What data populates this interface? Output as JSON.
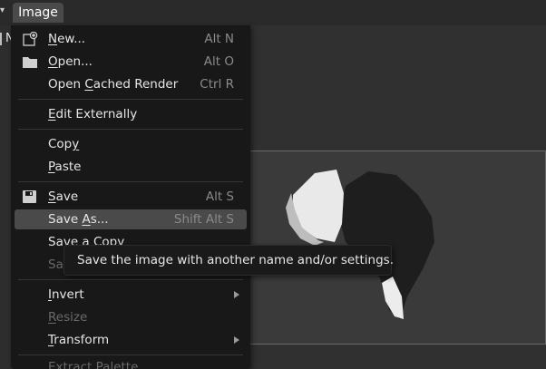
{
  "header": {
    "menu_label": "Image",
    "left_arrow": "▾"
  },
  "side": {
    "letter": "N"
  },
  "menu": {
    "items": [
      {
        "label": "New...",
        "ul": "N",
        "shortcut": "Alt N",
        "icon": "new-image-icon"
      },
      {
        "label": "Open...",
        "ul": "O",
        "shortcut": "Alt O",
        "icon": "folder-icon"
      },
      {
        "label": "Open Cached Render",
        "ul": "C",
        "shortcut": "Ctrl R"
      },
      {
        "label": "Edit Externally",
        "ul": "E",
        "shortcut": ""
      },
      {
        "label": "Copy",
        "ul": "y",
        "shortcut": ""
      },
      {
        "label": "Paste",
        "ul": "P",
        "shortcut": ""
      },
      {
        "label": "Save",
        "ul": "S",
        "shortcut": "Alt S",
        "icon": "floppy-disk-icon"
      },
      {
        "label": "Save As...",
        "ul": "A",
        "shortcut": "Shift Alt S"
      },
      {
        "label": "Save a Copy",
        "shortcut": ""
      },
      {
        "label": "Sa",
        "shortcut": ""
      },
      {
        "label": "Invert",
        "ul": "I",
        "shortcut": "",
        "submenu": true
      },
      {
        "label": "Resize",
        "ul": "R",
        "shortcut": "",
        "disabled": true
      },
      {
        "label": "Transform",
        "ul": "T",
        "shortcut": "",
        "submenu": true
      },
      {
        "label": "Extract Palette",
        "shortcut": "",
        "disabled": true
      }
    ]
  },
  "tooltip": {
    "text": "Save the image with another name and/or settings."
  },
  "colors": {
    "menu_bg": "#181818",
    "highlight": "#4a4a4a",
    "shortcut": "#8a8a8a"
  }
}
